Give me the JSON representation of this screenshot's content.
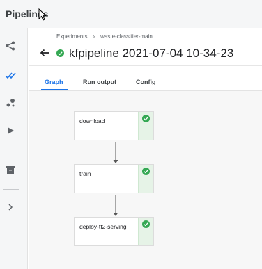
{
  "app": {
    "title": "Pipelines"
  },
  "nav": {
    "items": [
      {
        "icon": "pipelines-icon"
      },
      {
        "icon": "experiments-icon"
      },
      {
        "icon": "artifacts-icon"
      },
      {
        "icon": "executions-icon"
      },
      {
        "icon": "archive-icon"
      },
      {
        "icon": "expand-chevron-icon"
      }
    ]
  },
  "breadcrumb": {
    "items": [
      "Experiments",
      "waste-classifier-main"
    ],
    "separator": "›"
  },
  "run": {
    "title": "kfpipeline 2021-07-04 10-34-23",
    "status": "success"
  },
  "tabs": [
    "Graph",
    "Run output",
    "Config"
  ],
  "active_tab": "Graph",
  "graph": {
    "nodes": [
      {
        "label": "download",
        "status": "success"
      },
      {
        "label": "train",
        "status": "success"
      },
      {
        "label": "deploy-tf2-serving",
        "status": "success"
      }
    ]
  },
  "colors": {
    "accent": "#1a73e8",
    "success": "#34a853",
    "success_bg": "#e6f3e7"
  }
}
